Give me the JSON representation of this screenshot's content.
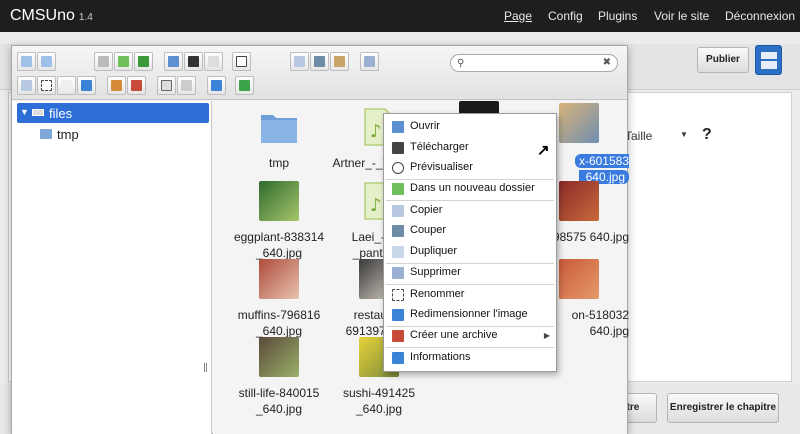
{
  "navbar": {
    "brand": "CMSUno",
    "version": "1.4",
    "links": [
      "Page",
      "Config",
      "Plugins",
      "Voir le site",
      "Déconnexion"
    ]
  },
  "background": {
    "publish_label": "Publier",
    "font_size_label": "Taille",
    "help_label": "?",
    "save_chapter_partial": "pitre",
    "save_chapter_label": "Enregistrer le chapitre"
  },
  "file_manager": {
    "search": {
      "value": "",
      "placeholder": ""
    },
    "tree": [
      {
        "label": "files",
        "selected": true,
        "expanded": true
      },
      {
        "label": "tmp",
        "selected": false
      }
    ],
    "files": [
      {
        "name": "tmp",
        "type": "folder"
      },
      {
        "name": "Artner_-_Translat",
        "type": "audio"
      },
      {
        "name": "",
        "type": "image"
      },
      {
        "name": "x-601583 _640.jpg",
        "type": "image",
        "selected": true
      },
      {
        "name": "eggplant-838314 _640.jpg",
        "type": "image"
      },
      {
        "name": "Laei_-_Pe _pantin_a",
        "type": "audio"
      },
      {
        "name": "",
        "type": "image"
      },
      {
        "name": "sli-698575 640.jpg",
        "type": "image"
      },
      {
        "name": "muffins-796816 _640.jpg",
        "type": "image"
      },
      {
        "name": "restauran 691397_640",
        "type": "image"
      },
      {
        "name": "",
        "type": "image"
      },
      {
        "name": "on-518032 640.jpg",
        "type": "image"
      },
      {
        "name": "still-life-840015 _640.jpg",
        "type": "image"
      },
      {
        "name": "sushi-491425 _640.jpg",
        "type": "image"
      }
    ]
  },
  "context_menu": {
    "items": [
      {
        "label": "Ouvrir",
        "icon": "open-icon"
      },
      {
        "label": "Télécharger",
        "icon": "download-icon"
      },
      {
        "label": "Prévisualiser",
        "icon": "eye-icon"
      },
      {
        "label": "Dans un nouveau dossier",
        "icon": "new-folder-icon"
      },
      {
        "label": "Copier",
        "icon": "copy-icon"
      },
      {
        "label": "Couper",
        "icon": "scissors-icon"
      },
      {
        "label": "Dupliquer",
        "icon": "duplicate-icon"
      },
      {
        "label": "Supprimer",
        "icon": "trash-icon"
      },
      {
        "label": "Renommer",
        "icon": "rename-icon"
      },
      {
        "label": "Redimensionner l'image",
        "icon": "resize-icon"
      },
      {
        "label": "Créer une archive",
        "icon": "archive-icon"
      },
      {
        "label": "Informations",
        "icon": "info-icon"
      }
    ]
  }
}
